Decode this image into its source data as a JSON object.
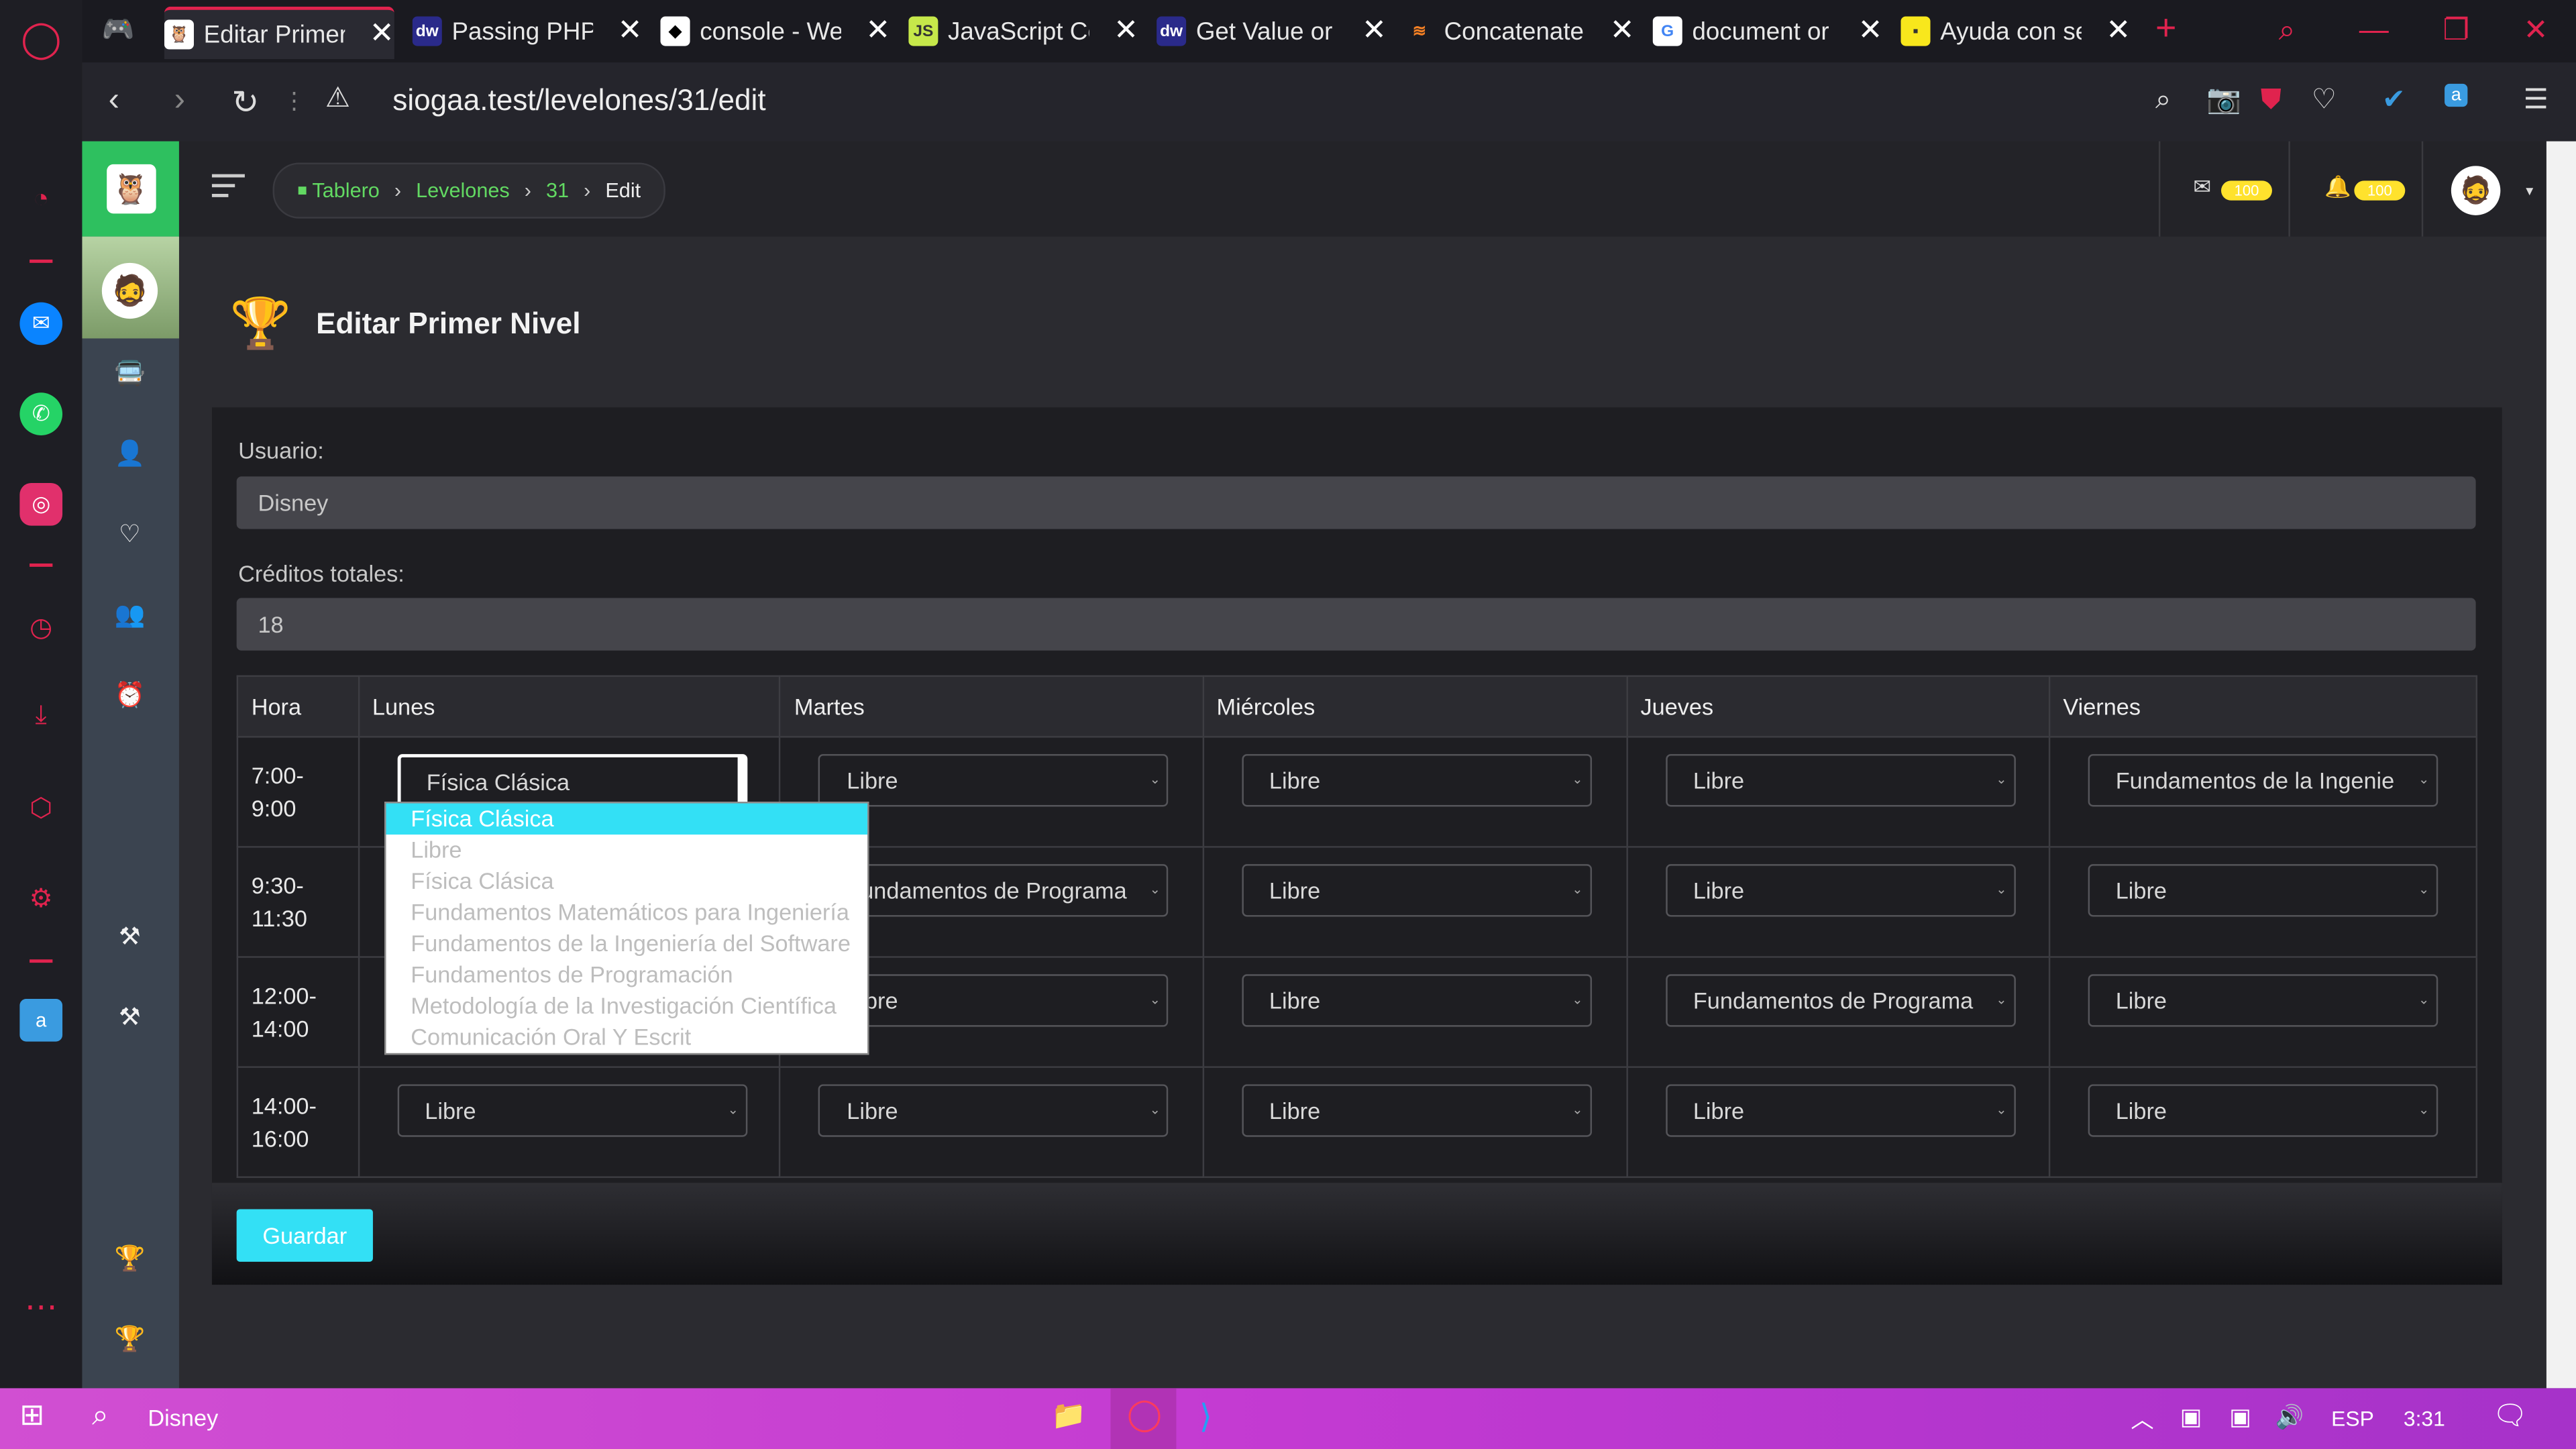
{
  "browser": {
    "tabs": [
      {
        "label": "Editar Primer",
        "fav": "mask",
        "active": true
      },
      {
        "label": "Passing PHP",
        "fav": "dw"
      },
      {
        "label": "console - We",
        "fav": "cw"
      },
      {
        "label": "JavaScript Co",
        "fav": "js"
      },
      {
        "label": "Get Value or",
        "fav": "dw"
      },
      {
        "label": "Concatenate",
        "fav": "so"
      },
      {
        "label": "document or",
        "fav": "g"
      },
      {
        "label": "Ayuda con se",
        "fav": "y"
      }
    ],
    "url": "siogaa.test/levelones/31/edit"
  },
  "breadcrumb": [
    {
      "label": "Tablero",
      "link": true
    },
    {
      "label": "Levelones",
      "link": true
    },
    {
      "label": "31",
      "link": true
    },
    {
      "label": "Edit",
      "link": false
    }
  ],
  "header": {
    "mail_count": "100",
    "notif_count": "100"
  },
  "page": {
    "title": "Editar Primer Nivel"
  },
  "form": {
    "usuario_label": "Usuario:",
    "usuario_value": "Disney",
    "creditos_label": "Créditos totales:",
    "creditos_value": "18",
    "save_label": "Guardar"
  },
  "schedule": {
    "headers": [
      "Hora",
      "Lunes",
      "Martes",
      "Miércoles",
      "Jueves",
      "Viernes"
    ],
    "rows": [
      {
        "hora": [
          "7:00-",
          "9:00"
        ],
        "cells": [
          "Física Clásica",
          "Libre",
          "Libre",
          "Libre",
          "Fundamentos de la Ingenie"
        ]
      },
      {
        "hora": [
          "9:30-",
          "11:30"
        ],
        "cells": [
          "",
          "Fundamentos de Programa",
          "Libre",
          "Libre",
          "Libre"
        ]
      },
      {
        "hora": [
          "12:00-",
          "14:00"
        ],
        "cells": [
          "",
          "Libre",
          "Libre",
          "Fundamentos de Programa",
          "Libre"
        ]
      },
      {
        "hora": [
          "14:00-",
          "16:00"
        ],
        "cells": [
          "Libre",
          "Libre",
          "Libre",
          "Libre",
          "Libre"
        ]
      }
    ]
  },
  "dropdown": {
    "options": [
      "Física Clásica",
      "Libre",
      "Física Clásica",
      "Fundamentos Matemáticos para Ingeniería",
      "Fundamentos de la Ingeniería del Software",
      "Fundamentos de Programación",
      "Metodología de la Investigación Científica",
      "Comunicación Oral Y Escrit"
    ],
    "selected_index": 0
  },
  "taskbar": {
    "search_text": "Disney",
    "lang": "ESP",
    "time": "3:31"
  },
  "colors": {
    "accent": "#33e0f5",
    "brand_green": "#2ec05f",
    "opera_red": "#e0234e"
  }
}
